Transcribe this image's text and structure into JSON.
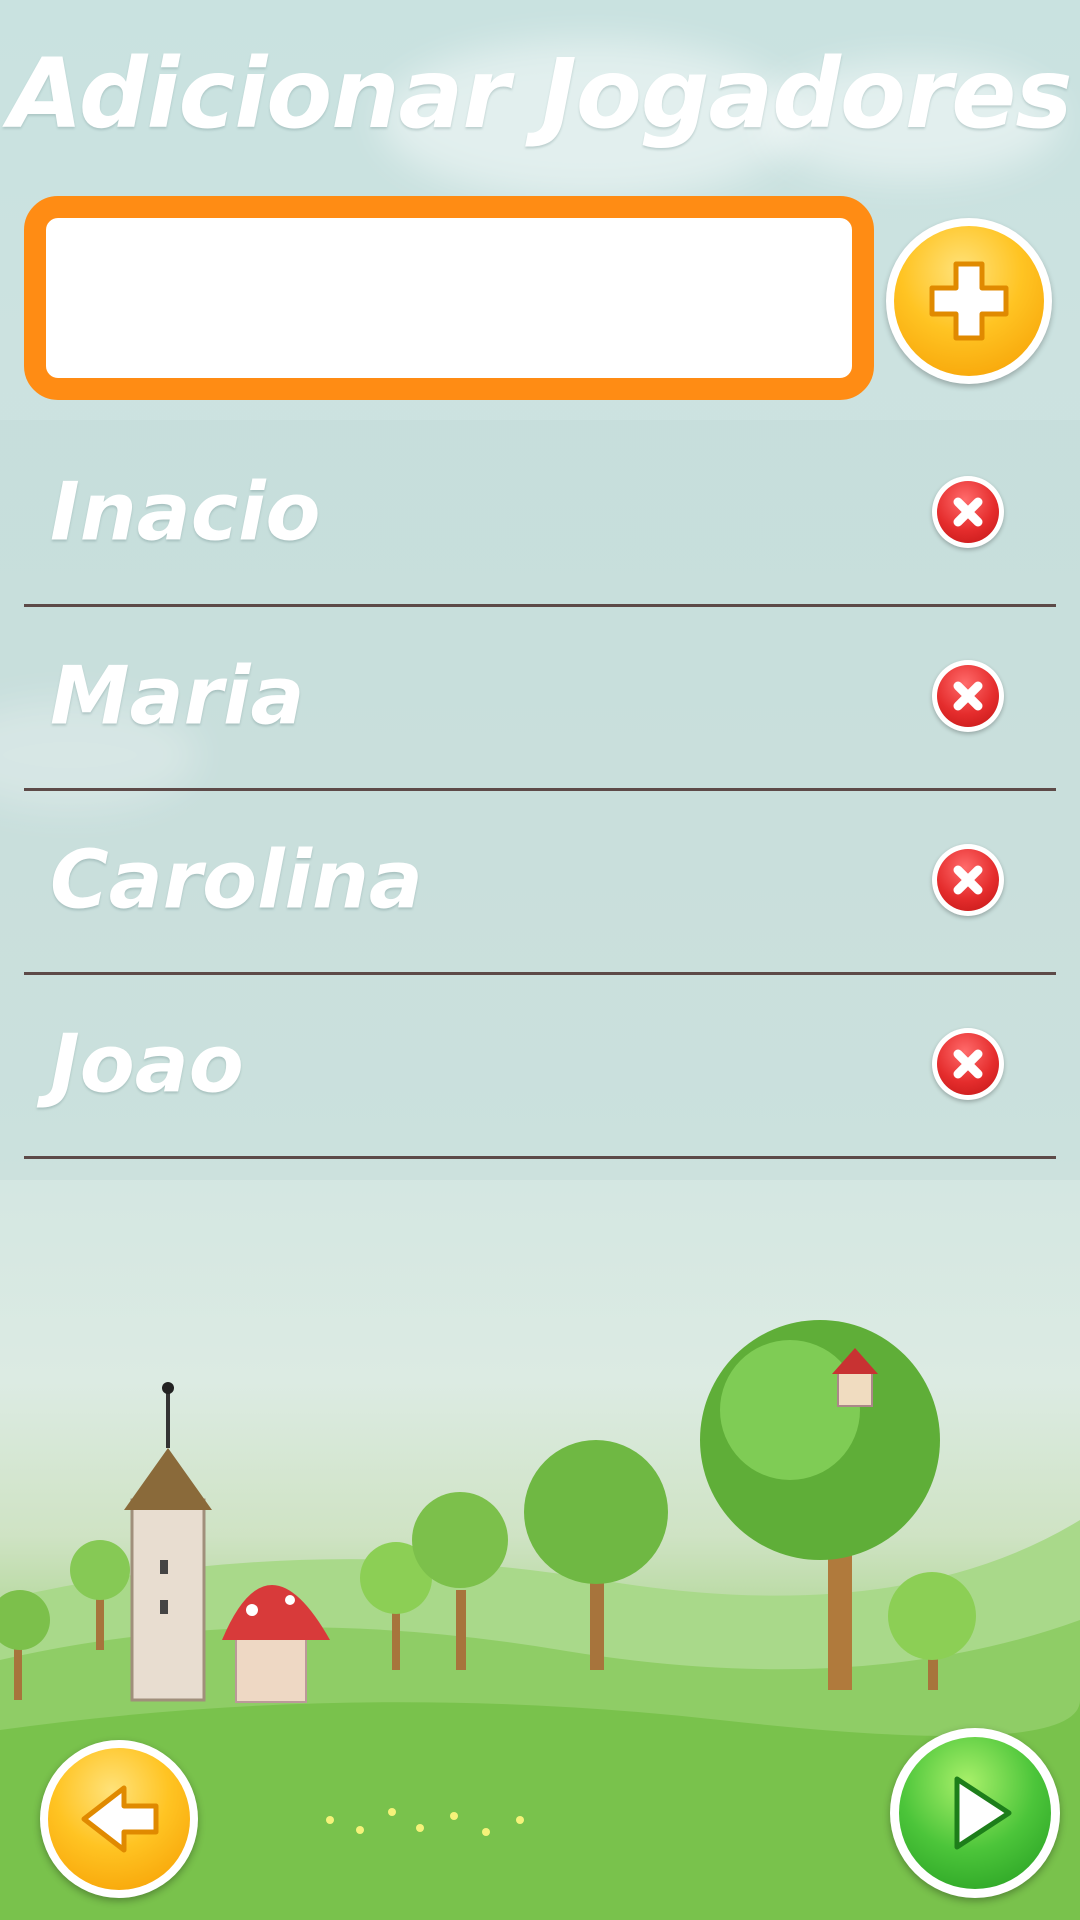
{
  "screen": {
    "title": "Adicionar Jogadores"
  },
  "name_input": {
    "value": "",
    "placeholder": ""
  },
  "add_button": {
    "icon": "plus-icon"
  },
  "players": [
    {
      "name": "Inacio",
      "remove_icon": "close-icon"
    },
    {
      "name": "Maria",
      "remove_icon": "close-icon"
    },
    {
      "name": "Carolina",
      "remove_icon": "close-icon"
    },
    {
      "name": "Joao",
      "remove_icon": "close-icon"
    }
  ],
  "navigation": {
    "back_icon": "arrow-left-icon",
    "play_icon": "play-icon"
  },
  "colors": {
    "input_border": "#ff8c14",
    "add_button": "#ffc423",
    "remove_button": "#e52d2d",
    "play_button": "#4cc53a",
    "back_button": "#ffc423",
    "row_divider": "#5d4a48",
    "text": "#ffffff"
  }
}
